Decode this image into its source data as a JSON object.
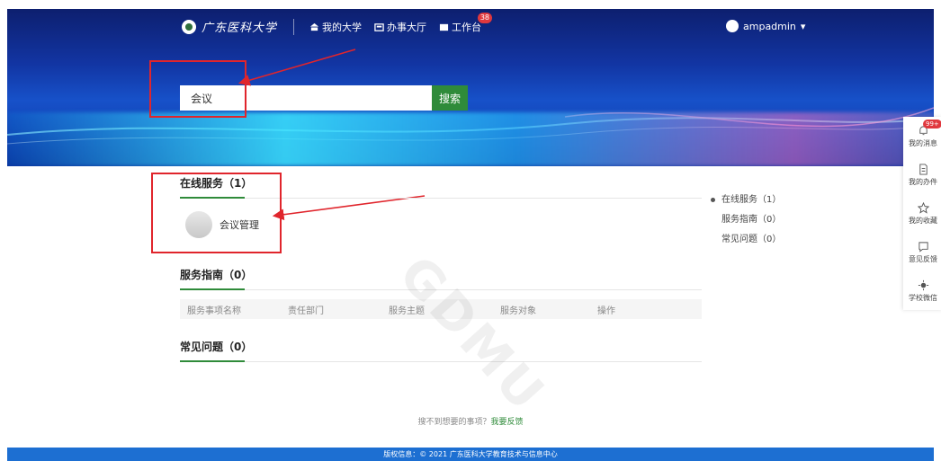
{
  "header": {
    "logo_text": "广东医科大学",
    "nav": [
      {
        "label": "我的大学",
        "icon": "university-icon"
      },
      {
        "label": "办事大厅",
        "icon": "hall-icon"
      },
      {
        "label": "工作台",
        "icon": "workbench-icon",
        "badge": "38"
      }
    ],
    "user": "ampadmin"
  },
  "search": {
    "value": "会议",
    "button": "搜索"
  },
  "sections": {
    "online": {
      "title": "在线服务（1）",
      "items": [
        {
          "label": "会议管理"
        }
      ]
    },
    "guide": {
      "title": "服务指南（0）",
      "columns": [
        "服务事项名称",
        "责任部门",
        "服务主题",
        "服务对象",
        "操作"
      ]
    },
    "faq": {
      "title": "常见问题（0）"
    }
  },
  "right_nav": [
    {
      "label": "在线服务（1）"
    },
    {
      "label": "服务指南（0）"
    },
    {
      "label": "常见问题（0）"
    }
  ],
  "dock": [
    {
      "label": "我的消息",
      "badge": "99+",
      "icon": "bell-icon"
    },
    {
      "label": "我的办件",
      "icon": "document-icon"
    },
    {
      "label": "我的收藏",
      "icon": "star-icon"
    },
    {
      "label": "意见反馈",
      "icon": "feedback-icon"
    },
    {
      "label": "学校微信",
      "icon": "wechat-icon"
    }
  ],
  "hint": {
    "text": "搜不到想要的事项？",
    "link": "我要反馈"
  },
  "footer": "版权信息：© 2021 广东医科大学教育技术与信息中心",
  "watermark": "GDMU",
  "colors": {
    "accent": "#2f8b3a",
    "annotation": "#e0252c",
    "footer": "#1d6fd2"
  }
}
